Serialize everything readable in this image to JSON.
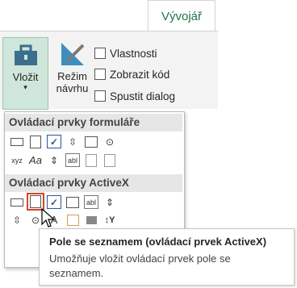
{
  "ribbon": {
    "tab_label": "Vývojář",
    "insert_label_1": "Vložit",
    "insert_label_2": "▾",
    "design_label_1": "Režim",
    "design_label_2": "návrhu",
    "properties_label": "Vlastnosti",
    "view_code_label": "Zobrazit kód",
    "run_dialog_label": "Spustit dialog"
  },
  "dropdown": {
    "form_controls_header": "Ovládací prvky formuláře",
    "activex_header": "Ovládací prvky ActiveX",
    "form_row2_label_icon": "Aa",
    "form_row2_text_icon": "abl",
    "activex_row1_text_icon": "abl",
    "activex_row2_label_icon": "A"
  },
  "tooltip": {
    "title": "Pole se seznamem (ovládací prvek ActiveX)",
    "description": "Umožňuje vložit ovládací prvek pole se seznamem."
  },
  "colors": {
    "accent": "#217346",
    "highlight": "#d24726"
  }
}
